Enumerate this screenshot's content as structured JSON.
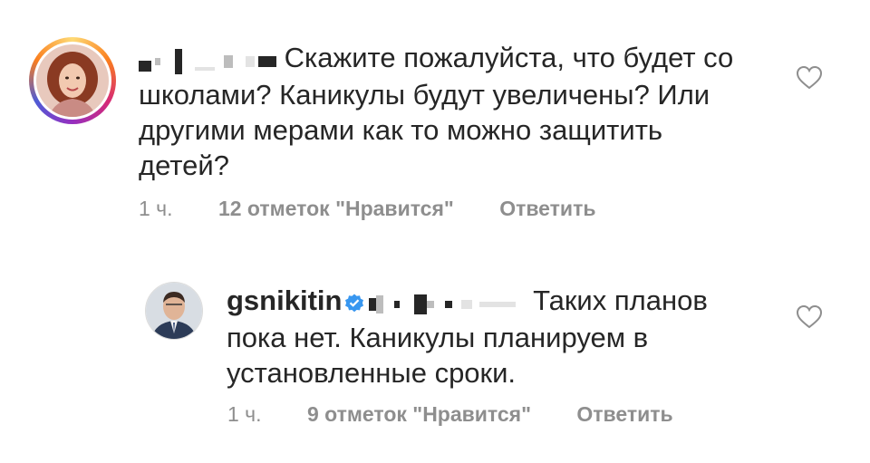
{
  "comments": [
    {
      "text": "Скажите пожалуйста, что будет со школами? Каникулы будут увеличены? Или другими мерами как то можно защитить детей?",
      "line1": "Скажите пожалуйста, что будет со",
      "line2": "школами? Каникулы будут увеличены? Или",
      "line3": "другими мерами как то можно защитить",
      "line4": "детей?",
      "time": "1 ч.",
      "likes": "12 отметок \"Нравится\"",
      "reply": "Ответить"
    },
    {
      "username": "gsnikitin",
      "line1": "Таких планов",
      "line2": "пока нет. Каникулы планируем в",
      "line3": "установленные сроки.",
      "time": "1 ч.",
      "likes": "9 отметок \"Нравится\"",
      "reply": "Ответить"
    }
  ],
  "icons": {
    "like": "heart-outline-icon",
    "verified": "verified-badge-icon"
  },
  "colors": {
    "text": "#262626",
    "meta": "#8e8e8e",
    "verified": "#3897f0"
  }
}
